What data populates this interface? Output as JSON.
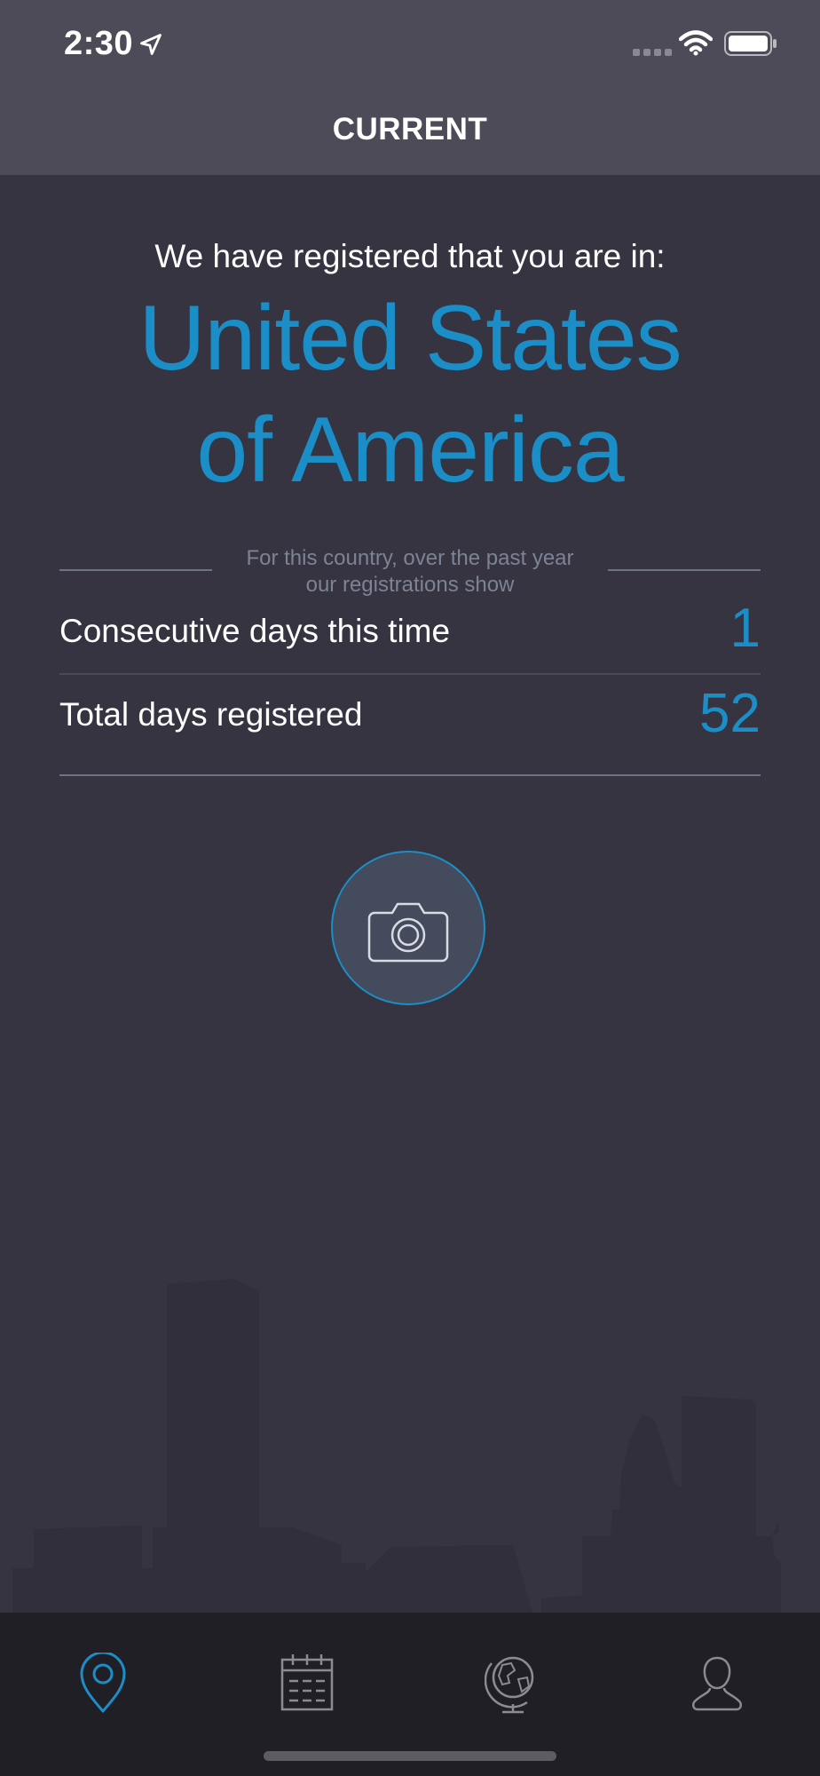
{
  "status_bar": {
    "time": "2:30"
  },
  "nav": {
    "title": "CURRENT"
  },
  "location": {
    "intro": "We have registered that you are in:",
    "country_line1": "United States",
    "country_line2": "of America"
  },
  "stats": {
    "period_note_line1": "For this country, over the past year",
    "period_note_line2": "our registrations show",
    "rows": [
      {
        "label": "Consecutive days this time",
        "value": "1"
      },
      {
        "label": "Total days registered",
        "value": "52"
      }
    ]
  },
  "camera_button": {
    "icon": "camera-icon"
  },
  "tabs": [
    {
      "icon": "location-pin-icon",
      "active": true
    },
    {
      "icon": "calendar-icon",
      "active": false
    },
    {
      "icon": "globe-icon",
      "active": false
    },
    {
      "icon": "person-icon",
      "active": false
    }
  ],
  "colors": {
    "accent": "#1b8ec7",
    "background": "#363441",
    "header": "#4d4b57",
    "tabbar": "#211f26"
  }
}
